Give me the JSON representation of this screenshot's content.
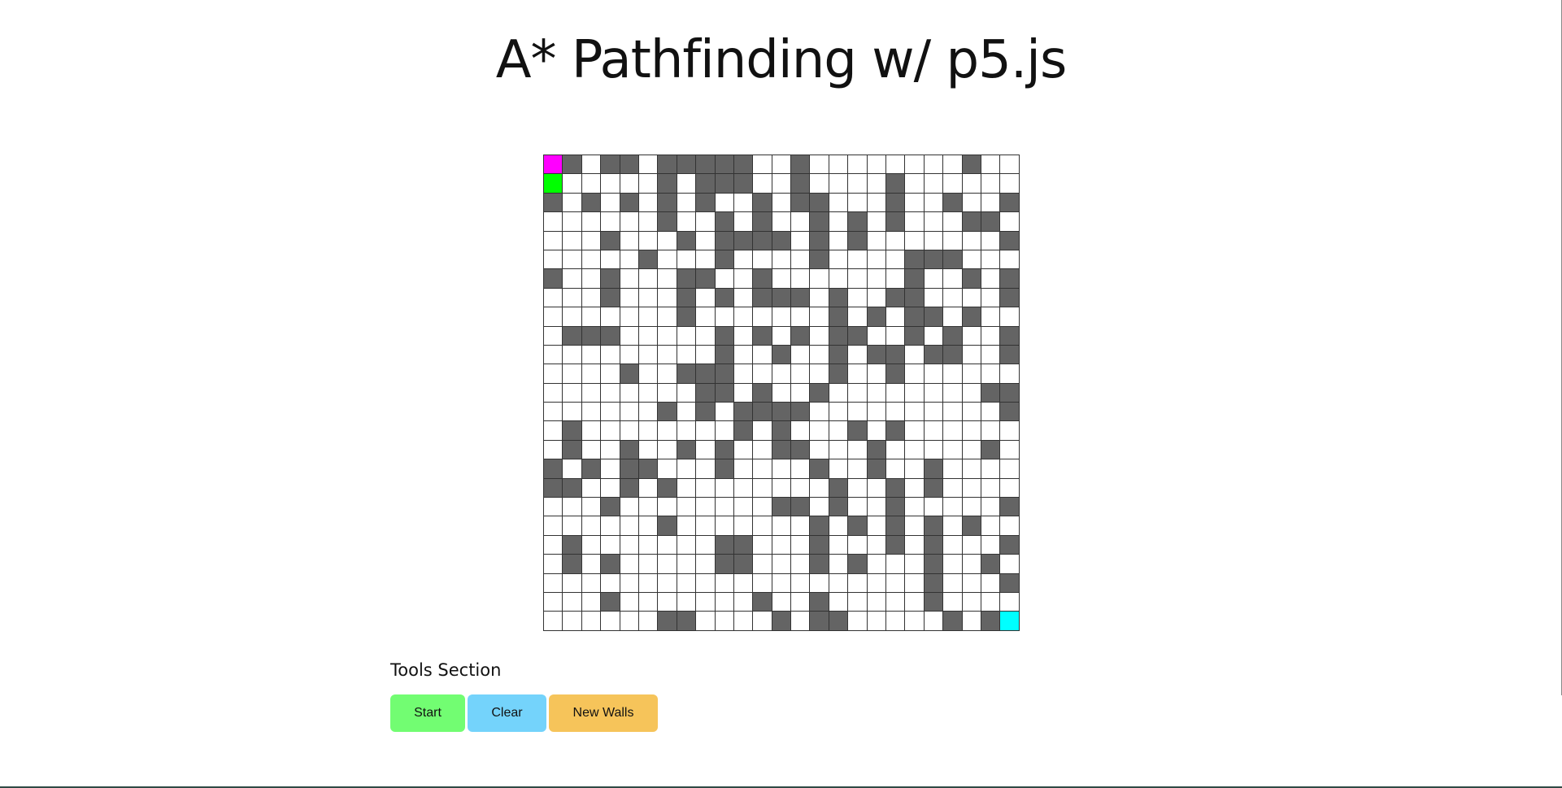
{
  "header": {
    "title": "A* Pathfinding w/ p5.js"
  },
  "grid": {
    "rows": 25,
    "cols": 25,
    "colors": {
      "empty": "#ffffff",
      "wall": "#646464",
      "start": "#ff00ff",
      "current": "#00ff00",
      "end": "#00ffff",
      "line": "#333333"
    },
    "special_cells": [
      {
        "row": 0,
        "col": 0,
        "kind": "start"
      },
      {
        "row": 1,
        "col": 0,
        "kind": "current"
      },
      {
        "row": 24,
        "col": 24,
        "kind": "end"
      }
    ],
    "cells": [
      ".#.##.#####..#........#..",
      "......#.###..#....#......",
      "#.#.#.#.#..#.##...#..#..#",
      "......#..#.#..#.#.#...##.",
      "...#...#.####.#.#.......#",
      ".....#...#....#....###...",
      "#..#...##..#.......#..#.#",
      "...#...#.#.###.#..##....#",
      ".......#.......#.#.##.#..",
      ".###.....#.#.#.##..#.#..#",
      ".........#..#..#.##.##..#",
      "....#..###.....#..#......",
      "........##.#..#........##",
      "......#.#.####..........#",
      ".#........#.#...#.#......",
      ".#..#..#.#..##...#.....#.",
      "#.#.##...#....#..#..#....",
      "##..#.#........#..#.#....",
      "...#........##.#..#.....#",
      "......#.......#.#.#.#.#..",
      ".#.......##...#...#.#...#",
      ".#.#.....##...#.#...#..#.",
      "....................#...#",
      "...#.......#..#.....#....",
      "......##....#.##.....#.#."
    ]
  },
  "tools": {
    "heading": "Tools Section",
    "start_label": "Start",
    "clear_label": "Clear",
    "new_walls_label": "New Walls",
    "start_color": "#72fd72",
    "clear_color": "#74d3fb",
    "new_walls_color": "#f6c45a"
  }
}
